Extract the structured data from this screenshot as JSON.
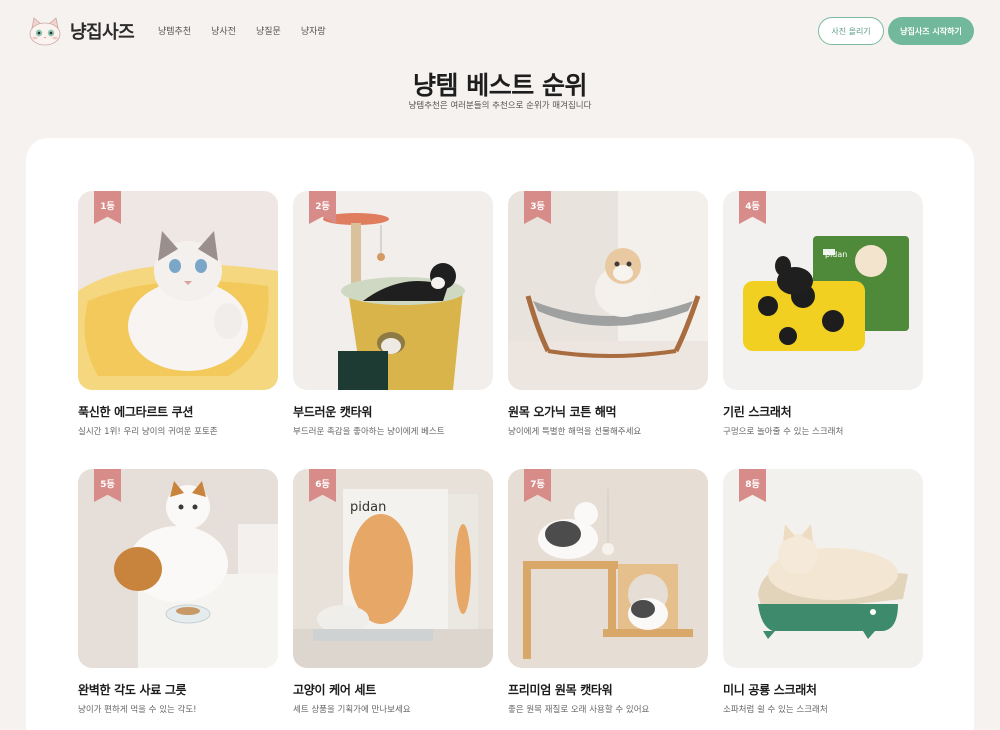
{
  "header": {
    "logo_text": "냥집사즈",
    "nav": [
      "냥템추천",
      "냥사전",
      "냥질문",
      "냥자랑"
    ],
    "upload_button": "사진 올리기",
    "start_button": "냥집사즈 시작하기"
  },
  "page": {
    "title": "냥템 베스트 순위",
    "subtitle": "냥템추천은 여러분들의 추천으로 순위가 매겨집니다"
  },
  "products": [
    {
      "rank": "1등",
      "name": "푹신한 에그타르트 쿠션",
      "desc": "실시간 1위! 우리 냥이의 귀여운 포토존"
    },
    {
      "rank": "2등",
      "name": "부드러운 캣타워",
      "desc": "부드러운 촉감을 좋아하는 냥이에게 베스트"
    },
    {
      "rank": "3등",
      "name": "원목 오가닉 코튼 해먹",
      "desc": "냥이에게 특별한 해먹을 선물해주세요"
    },
    {
      "rank": "4등",
      "name": "기린 스크래처",
      "desc": "구멍으로 놀아줄 수 있는 스크래처"
    },
    {
      "rank": "5등",
      "name": "완벽한 각도 사료 그릇",
      "desc": "냥이가 편하게 먹을 수 있는 각도!"
    },
    {
      "rank": "6등",
      "name": "고양이 케어 세트",
      "desc": "세트 상품을 기획가에 만나보세요"
    },
    {
      "rank": "7등",
      "name": "프리미엄 원목 캣타워",
      "desc": "좋은 원목 재질로 오래 사용할 수 있어요"
    },
    {
      "rank": "8등",
      "name": "미니 공룡 스크래처",
      "desc": "소파처럼 쉴 수 있는 스크래처"
    }
  ],
  "image_labels": {
    "brand_4": "pidan",
    "brand_6": "pidan"
  },
  "colors": {
    "accent": "#72b89c",
    "rank_ribbon": "#d88c8a",
    "background": "#f6f2f0"
  }
}
